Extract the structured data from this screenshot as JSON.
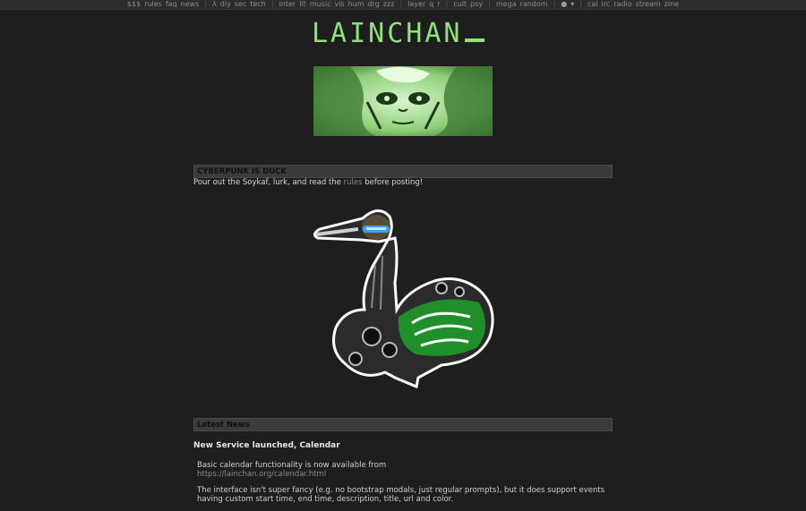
{
  "topbar": {
    "groups": [
      [
        "$$$",
        "rules",
        "faq",
        "news"
      ],
      [
        "λ",
        "diy",
        "sec",
        "tech"
      ],
      [
        "inter",
        "lit",
        "music",
        "vis",
        "hum",
        "drg",
        "zzz"
      ],
      [
        "layer",
        "q",
        "r"
      ],
      [
        "cult",
        "psy"
      ],
      [
        "mega",
        "random"
      ],
      [
        "github-icon",
        "twitter-icon"
      ],
      [
        "cal",
        "irc",
        "radio",
        "stream",
        "zine"
      ]
    ]
  },
  "logo": {
    "text": "LAINCHAN"
  },
  "announcement": {
    "header": "CYBERPUNK IS DUCK",
    "text_before": "Pour out the Soykaf, lurk, and read the ",
    "link": "rules",
    "text_after": " before posting!"
  },
  "news": {
    "header": "Latest News",
    "title": "New Service launched, Calendar",
    "p1": "Basic calendar functionality is now available from",
    "p1_link": "https://lainchan.org/calendar.html",
    "p2": "The interface isn't super fancy (e.g. no bootstrap modals, just regular prompts), but it does support events having custom start time, end time, description, title, url and color."
  },
  "colors": {
    "background": "#1e1e1e",
    "accent_green": "#8fe37a",
    "header_bg": "#3b3b3b"
  }
}
